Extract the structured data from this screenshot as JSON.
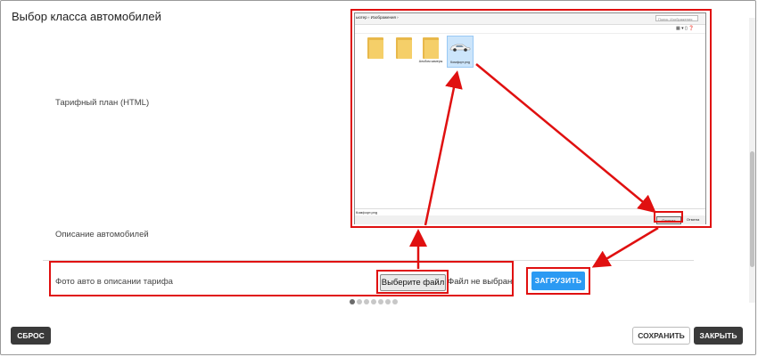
{
  "header": {
    "title": "Выбор класса автомобилей"
  },
  "fields": {
    "tariff_label": "Тарифный план (HTML)",
    "description_label": "Описание автомобилей",
    "photo_label": "Фото авто в описании тарифа"
  },
  "file_input": {
    "button_label": "Выберите файл",
    "status_text": "Файл не выбран"
  },
  "upload_button": {
    "label": "ЗАГРУЗИТЬ"
  },
  "pagination": {
    "count": 7,
    "active_index": 0
  },
  "footer": {
    "reset_label": "СБРОС",
    "save_label": "СОХРАНИТЬ",
    "close_label": "ЗАКРЫТЬ"
  },
  "file_dialog": {
    "breadcrumb": "ьютер › Изображения ›",
    "search_placeholder": "Поиск: Изображения",
    "items": [
      {
        "name": "",
        "icon": "folder-icon"
      },
      {
        "name": "",
        "icon": "folder-icon"
      },
      {
        "name": "Альбом камеры",
        "icon": "folder-icon"
      },
      {
        "name": "Комфорт.png",
        "icon": "image-thumbnail-icon"
      }
    ],
    "filename_value": "Комфорт.png",
    "open_label": "Открыть",
    "cancel_label": "Отмена"
  },
  "colors": {
    "highlight": "#e01010",
    "primary": "#2b9af3",
    "dark_button": "#3a3a3a"
  }
}
